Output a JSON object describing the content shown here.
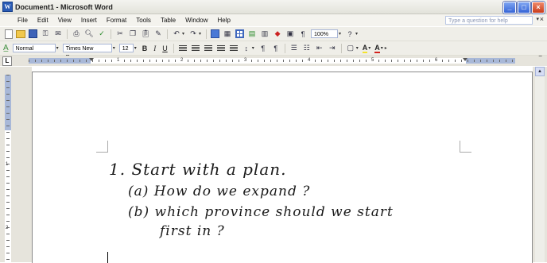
{
  "window": {
    "title": "Document1 - Microsoft Word",
    "controls": [
      "minimize",
      "maximize",
      "close"
    ]
  },
  "menu": {
    "items": [
      "File",
      "Edit",
      "View",
      "Insert",
      "Format",
      "Tools",
      "Table",
      "Window",
      "Help"
    ],
    "help_placeholder": "Type a question for help"
  },
  "standard_toolbar": {
    "zoom": "100%",
    "icons": [
      "new-document-icon",
      "open-folder-icon",
      "save-icon",
      "permission-icon",
      "email-icon",
      "print-icon",
      "print-preview-icon",
      "spelling-icon",
      "cut-icon",
      "copy-icon",
      "paste-icon",
      "format-painter-icon",
      "undo-icon",
      "redo-icon",
      "hyperlink-icon",
      "tables-borders-icon",
      "insert-table-icon",
      "insert-excel-icon",
      "columns-icon",
      "drawing-icon",
      "document-map-icon",
      "show-formatting-icon",
      "help-icon"
    ]
  },
  "formatting_toolbar": {
    "style": "Normal",
    "font": "Times New Roman",
    "size": "12",
    "bold": "B",
    "italic": "I",
    "underline": "U",
    "highlight": "A",
    "font_color": "A"
  },
  "ruler": {
    "numbers": [
      "1",
      "2",
      "3",
      "4",
      "5",
      "6"
    ],
    "vertical_numbers": [
      "1",
      "2"
    ]
  },
  "document": {
    "ink_lines": [
      "1. Start with a plan.",
      "(a) How do we expand ?",
      "(b) which province should we start",
      "first in ?"
    ]
  },
  "colors": {
    "titlebar": "#e8e8e0",
    "close_button": "#d14b2a",
    "minmax_button": "#3f6fd8",
    "ruler_margin": "#a8b8d8"
  }
}
